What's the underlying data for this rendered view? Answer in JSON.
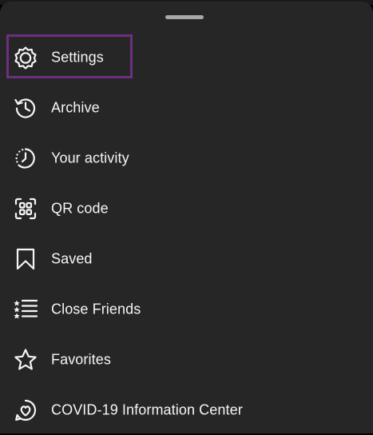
{
  "menu": {
    "items": [
      {
        "label": "Settings",
        "icon": "gear-icon"
      },
      {
        "label": "Archive",
        "icon": "archive-history-icon"
      },
      {
        "label": "Your activity",
        "icon": "activity-clock-icon"
      },
      {
        "label": "QR code",
        "icon": "qr-code-icon"
      },
      {
        "label": "Saved",
        "icon": "bookmark-icon"
      },
      {
        "label": "Close Friends",
        "icon": "close-friends-list-icon"
      },
      {
        "label": "Favorites",
        "icon": "star-icon"
      },
      {
        "label": "COVID-19 Information Center",
        "icon": "heart-badge-icon"
      }
    ]
  },
  "colors": {
    "sheet_background": "#262626",
    "text": "#f5f5f5",
    "highlight_border": "#6e2f80",
    "handle": "#a8a8a8"
  }
}
